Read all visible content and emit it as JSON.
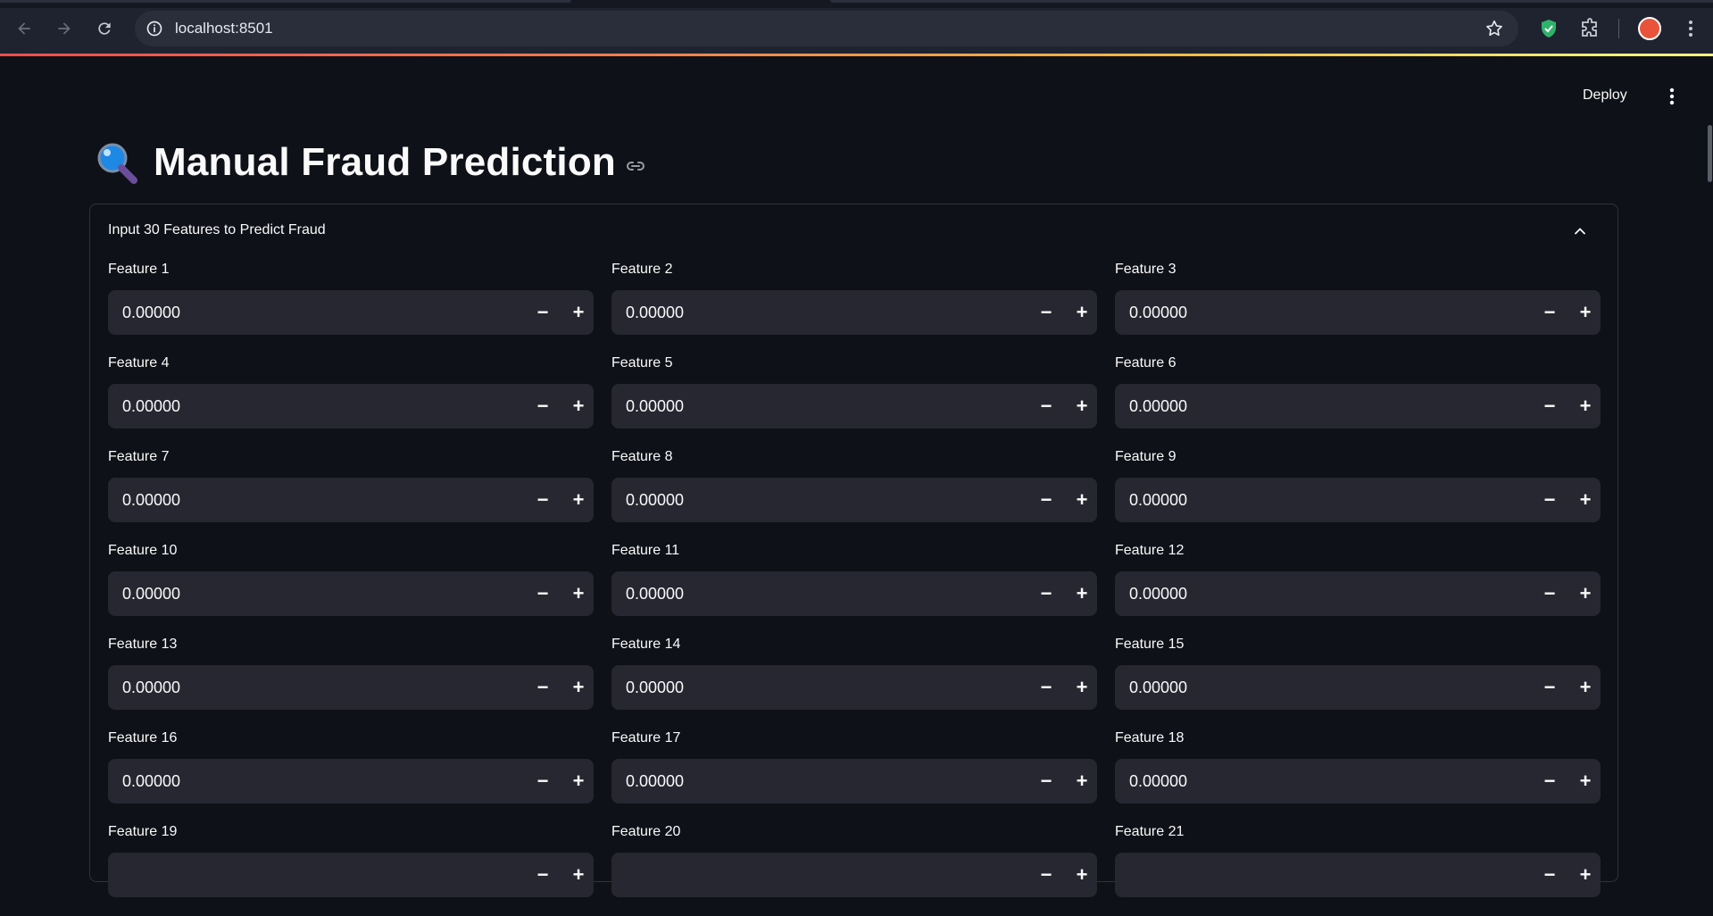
{
  "browser": {
    "url": "localhost:8501",
    "nav": [
      "back-icon",
      "forward-icon",
      "reload-icon"
    ],
    "extensions": [
      "shield-check-icon",
      "puzzle-icon"
    ]
  },
  "app": {
    "deploy_label": "Deploy",
    "title": "Manual Fraud Prediction",
    "title_icon": "magnifying-glass-icon",
    "expander_label": "Input 30 Features to Predict Fraud",
    "gradient_colors": [
      "#ff4b4b",
      "#ffbd45",
      "#fffd80"
    ]
  },
  "features": [
    {
      "label": "Feature 1",
      "value": "0.00000"
    },
    {
      "label": "Feature 2",
      "value": "0.00000"
    },
    {
      "label": "Feature 3",
      "value": "0.00000"
    },
    {
      "label": "Feature 4",
      "value": "0.00000"
    },
    {
      "label": "Feature 5",
      "value": "0.00000"
    },
    {
      "label": "Feature 6",
      "value": "0.00000"
    },
    {
      "label": "Feature 7",
      "value": "0.00000"
    },
    {
      "label": "Feature 8",
      "value": "0.00000"
    },
    {
      "label": "Feature 9",
      "value": "0.00000"
    },
    {
      "label": "Feature 10",
      "value": "0.00000"
    },
    {
      "label": "Feature 11",
      "value": "0.00000"
    },
    {
      "label": "Feature 12",
      "value": "0.00000"
    },
    {
      "label": "Feature 13",
      "value": "0.00000"
    },
    {
      "label": "Feature 14",
      "value": "0.00000"
    },
    {
      "label": "Feature 15",
      "value": "0.00000"
    },
    {
      "label": "Feature 16",
      "value": "0.00000"
    },
    {
      "label": "Feature 17",
      "value": "0.00000"
    },
    {
      "label": "Feature 18",
      "value": "0.00000"
    },
    {
      "label": "Feature 19",
      "value": ""
    },
    {
      "label": "Feature 20",
      "value": ""
    },
    {
      "label": "Feature 21",
      "value": ""
    }
  ],
  "stepper": {
    "minus": "−",
    "plus": "+"
  }
}
